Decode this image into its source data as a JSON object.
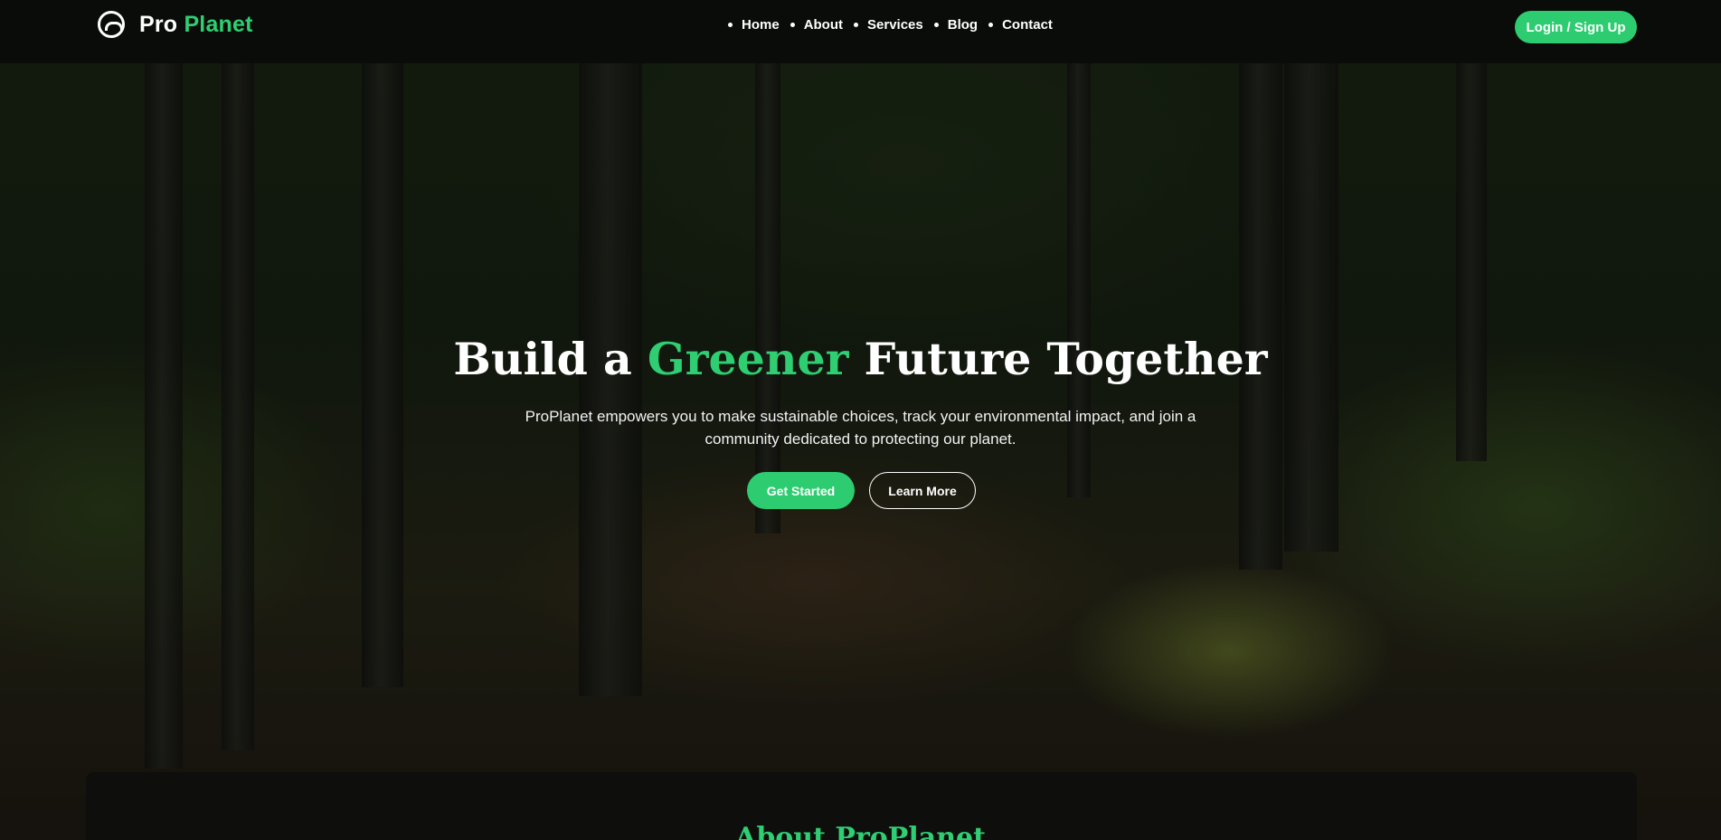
{
  "header": {
    "brand_part1": "Pro",
    "brand_part2": "Planet",
    "login_label": "Login / Sign Up"
  },
  "nav": {
    "items": [
      {
        "label": "Home"
      },
      {
        "label": "About"
      },
      {
        "label": "Services"
      },
      {
        "label": "Blog"
      },
      {
        "label": "Contact"
      }
    ]
  },
  "hero": {
    "title_before": "Build a",
    "title_accent": "Greener",
    "title_after": "Future Together",
    "subtitle": "ProPlanet empowers you to make sustainable choices, track your environmental impact, and join a community dedicated to protecting our planet.",
    "primary_cta": "Get Started",
    "secondary_cta": "Learn More"
  },
  "about": {
    "title": "About ProPlanet"
  },
  "colors": {
    "accent": "#2ecc71",
    "header_bg": "#080a08",
    "text": "#ffffff"
  },
  "icons": {
    "logo": "planet-logo-icon"
  }
}
